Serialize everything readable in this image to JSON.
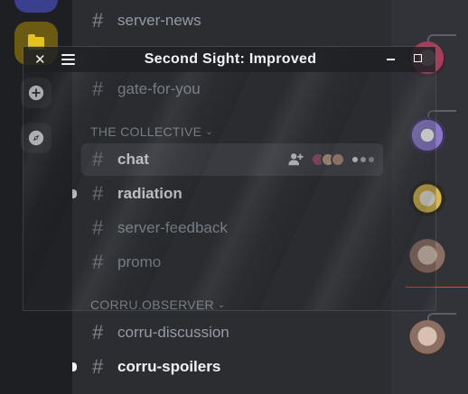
{
  "window": {
    "title": "Second Sight: Improved",
    "close_glyph": "✕",
    "menu_icon": "hamburger-icon",
    "minimize_icon": "minimize-icon",
    "maximize_icon": "maximize-icon"
  },
  "rail": {
    "add_server_icon": "plus-circle-icon",
    "explore_icon": "compass-icon",
    "folder_icon": "folder-icon"
  },
  "channels": {
    "items": [
      {
        "name": "server-news",
        "unread": false
      },
      {
        "name": "gate-for-you",
        "unread": false
      },
      {
        "name": "chat",
        "unread": true,
        "active": true
      },
      {
        "name": "radiation",
        "unread": true
      },
      {
        "name": "server-feedback",
        "unread": false
      },
      {
        "name": "promo",
        "unread": false
      },
      {
        "name": "corru-discussion",
        "unread": false
      },
      {
        "name": "corru-spoilers",
        "unread": true
      }
    ],
    "categories": [
      {
        "label": "THE COLLECTIVE"
      },
      {
        "label": "CORRU.OBSERVER"
      }
    ],
    "hash_glyph": "#",
    "chevron_glyph": "⌄"
  },
  "colors": {
    "accent_red": "#f23f43",
    "active_bg": "#404249",
    "text_bright": "#f2f3f5",
    "text_muted": "#949ba4"
  }
}
